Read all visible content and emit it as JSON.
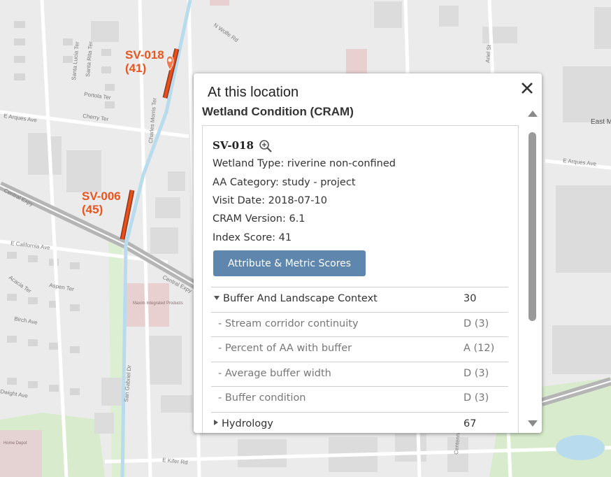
{
  "map": {
    "street_labels": [
      "E Arques Ave",
      "E Arques Ave",
      "E California Ave",
      "Central Expy",
      "Central Expy",
      "Santa Lucia Ter",
      "Santa Rita Ter",
      "Portola Ter",
      "Charles Morris Ter",
      "Cherry Ter",
      "Acacia Ter",
      "Aspen Ter",
      "Birch Ave",
      "Dwight Ave",
      "E Kifer Rd",
      "San Gabriel Dr",
      "Centennial Dr",
      "East M",
      "N Wolfe Rd",
      "Ariel St"
    ],
    "poi_labels": [
      "Maxim Integrated Products",
      "Home Depot"
    ]
  },
  "markers": [
    {
      "id": "SV-018",
      "score": "(41)"
    },
    {
      "id": "SV-006",
      "score": "(45)"
    }
  ],
  "popup": {
    "title": "At this location",
    "layer_name": "Wetland Condition (CRAM)",
    "feature_title": "SV-018",
    "attributes": [
      "Wetland Type: riverine non-confined",
      "AA Category: study - project",
      "Visit Date: 2018-07-10",
      "CRAM Version: 6.1",
      "Index Score: 41"
    ],
    "button_label": "Attribute & Metric Scores",
    "score_rows": [
      {
        "label": "Buffer And Landscape Context",
        "value": "30",
        "kind": "section",
        "expanded": true
      },
      {
        "label": "- Stream corridor continuity",
        "value": "D (3)",
        "kind": "sub"
      },
      {
        "label": "- Percent of AA with buffer",
        "value": "A (12)",
        "kind": "sub"
      },
      {
        "label": "- Average buffer width",
        "value": "D (3)",
        "kind": "sub"
      },
      {
        "label": "- Buffer condition",
        "value": "D (3)",
        "kind": "sub"
      },
      {
        "label": "Hydrology",
        "value": "67",
        "kind": "section",
        "expanded": false
      }
    ]
  },
  "colors": {
    "marker": "#e8551e",
    "segment": "#e94e1b",
    "button": "#5f86ad",
    "water": "#b8dcee",
    "park": "#d8eccd"
  },
  "icons": {
    "close": "close-icon",
    "zoom": "zoom-in-icon",
    "scroll_up": "scroll-up-icon",
    "scroll_down": "scroll-down-icon"
  }
}
